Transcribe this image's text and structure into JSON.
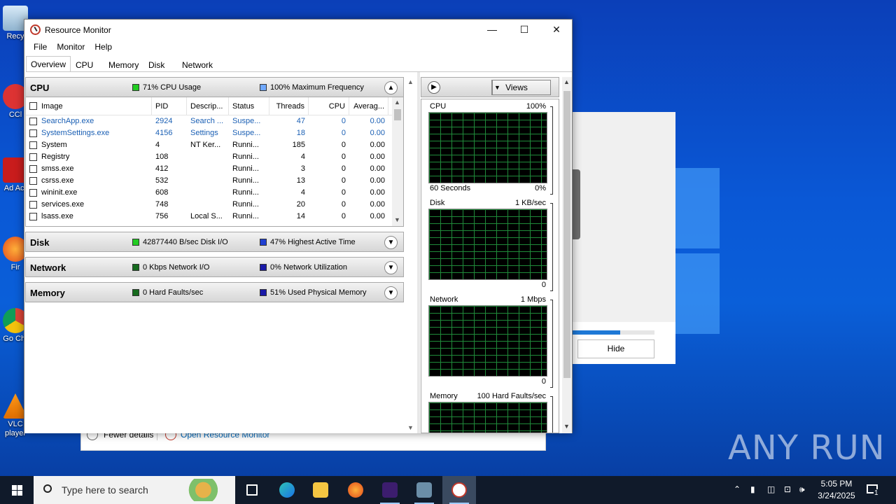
{
  "desktop": {
    "icons": [
      "Recy",
      "CCl",
      "Ad Acr",
      "Fir",
      "Go Chr",
      "VLC player"
    ]
  },
  "background_dialog": {
    "hide_label": "Hide",
    "progress": 0.58,
    "fewer_details": "Fewer details",
    "open_resource_monitor": "Open Resource Monitor"
  },
  "watermark": "ANY RUN",
  "window": {
    "title": "Resource Monitor",
    "controls": {
      "minimize": "—",
      "maximize": "☐",
      "close": "✕"
    }
  },
  "menu": [
    "File",
    "Monitor",
    "Help"
  ],
  "tabs": [
    "Overview",
    "CPU",
    "Memory",
    "Disk",
    "Network"
  ],
  "sections": {
    "cpu": {
      "name": "CPU",
      "stat1": "71% CPU Usage",
      "stat2": "100% Maximum Frequency",
      "stat1_color": "#22cc22",
      "stat2_color": "#6fa8ff"
    },
    "disk": {
      "name": "Disk",
      "stat1": "42877440 B/sec Disk I/O",
      "stat2": "47% Highest Active Time",
      "stat1_color": "#22cc22",
      "stat2_color": "#1f3fd1"
    },
    "network": {
      "name": "Network",
      "stat1": "0 Kbps Network I/O",
      "stat2": "0% Network Utilization",
      "stat1_color": "#166b1e",
      "stat2_color": "#1a1aa8"
    },
    "memory": {
      "name": "Memory",
      "stat1": "0 Hard Faults/sec",
      "stat2": "51% Used Physical Memory",
      "stat1_color": "#166b1e",
      "stat2_color": "#1a1aa8"
    }
  },
  "cpu_table": {
    "headers": [
      "Image",
      "PID",
      "Descrip...",
      "Status",
      "Threads",
      "CPU",
      "Averag..."
    ],
    "rows": [
      {
        "image": "SearchApp.exe",
        "pid": "2924",
        "desc": "Search ...",
        "status": "Suspe...",
        "threads": "47",
        "cpu": "0",
        "avg": "0.00",
        "highlight": true
      },
      {
        "image": "SystemSettings.exe",
        "pid": "4156",
        "desc": "Settings",
        "status": "Suspe...",
        "threads": "18",
        "cpu": "0",
        "avg": "0.00",
        "highlight": true
      },
      {
        "image": "System",
        "pid": "4",
        "desc": "NT Ker...",
        "status": "Runni...",
        "threads": "185",
        "cpu": "0",
        "avg": "0.00"
      },
      {
        "image": "Registry",
        "pid": "108",
        "desc": "",
        "status": "Runni...",
        "threads": "4",
        "cpu": "0",
        "avg": "0.00"
      },
      {
        "image": "smss.exe",
        "pid": "412",
        "desc": "",
        "status": "Runni...",
        "threads": "3",
        "cpu": "0",
        "avg": "0.00"
      },
      {
        "image": "csrss.exe",
        "pid": "532",
        "desc": "",
        "status": "Runni...",
        "threads": "13",
        "cpu": "0",
        "avg": "0.00"
      },
      {
        "image": "wininit.exe",
        "pid": "608",
        "desc": "",
        "status": "Runni...",
        "threads": "4",
        "cpu": "0",
        "avg": "0.00"
      },
      {
        "image": "services.exe",
        "pid": "748",
        "desc": "",
        "status": "Runni...",
        "threads": "20",
        "cpu": "0",
        "avg": "0.00"
      },
      {
        "image": "lsass.exe",
        "pid": "756",
        "desc": "Local S...",
        "status": "Runni...",
        "threads": "14",
        "cpu": "0",
        "avg": "0.00"
      }
    ]
  },
  "right_panel": {
    "views_label": "Views",
    "graphs": [
      {
        "name": "CPU",
        "top_right": "100%",
        "bottom_left": "60 Seconds",
        "bottom_right": "0%"
      },
      {
        "name": "Disk",
        "top_right": "1 KB/sec",
        "bottom_left": "",
        "bottom_right": "0"
      },
      {
        "name": "Network",
        "top_right": "1 Mbps",
        "bottom_left": "",
        "bottom_right": "0"
      },
      {
        "name": "Memory",
        "top_right": "100 Hard Faults/sec",
        "bottom_left": "",
        "bottom_right": ""
      }
    ]
  },
  "taskbar": {
    "search_placeholder": "Type here to search",
    "time": "5:05 PM",
    "date": "3/24/2025",
    "notification_count": "1"
  }
}
